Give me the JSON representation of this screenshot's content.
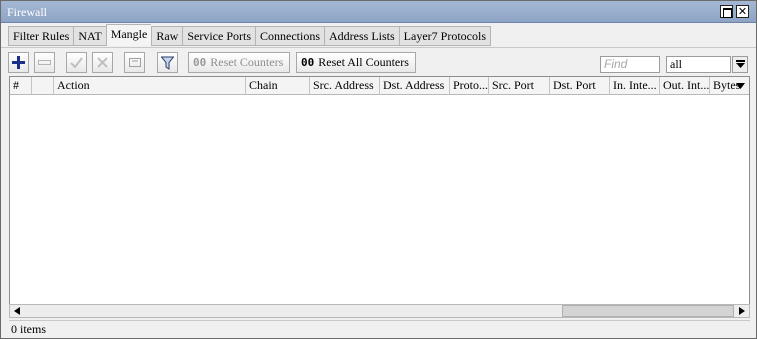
{
  "window": {
    "title": "Firewall"
  },
  "tabs": [
    {
      "label": "Filter Rules"
    },
    {
      "label": "NAT"
    },
    {
      "label": "Mangle",
      "active": true
    },
    {
      "label": "Raw"
    },
    {
      "label": "Service Ports"
    },
    {
      "label": "Connections"
    },
    {
      "label": "Address Lists"
    },
    {
      "label": "Layer7 Protocols"
    }
  ],
  "toolbar": {
    "reset_counters": {
      "icon_text": "00",
      "label": "Reset Counters"
    },
    "reset_all_counters": {
      "icon_text": "00",
      "label": "Reset All Counters"
    },
    "find_placeholder": "Find",
    "filter_value": "all"
  },
  "table": {
    "columns": [
      "#",
      "",
      "Action",
      "Chain",
      "Src. Address",
      "Dst. Address",
      "Proto...",
      "Src. Port",
      "Dst. Port",
      "In. Inte...",
      "Out. Int...",
      "Bytes"
    ],
    "rows": []
  },
  "status": {
    "text": "0 items"
  },
  "colors": {
    "titlebar": "#98aecb",
    "add_icon": "#1a2f8a"
  },
  "icons": [
    "restore-icon",
    "close-icon",
    "add-icon",
    "remove-icon",
    "enable-icon",
    "disable-icon",
    "comment-icon",
    "filter-icon",
    "dropdown-icon",
    "column-menu-icon",
    "scroll-left-icon",
    "scroll-right-icon"
  ]
}
